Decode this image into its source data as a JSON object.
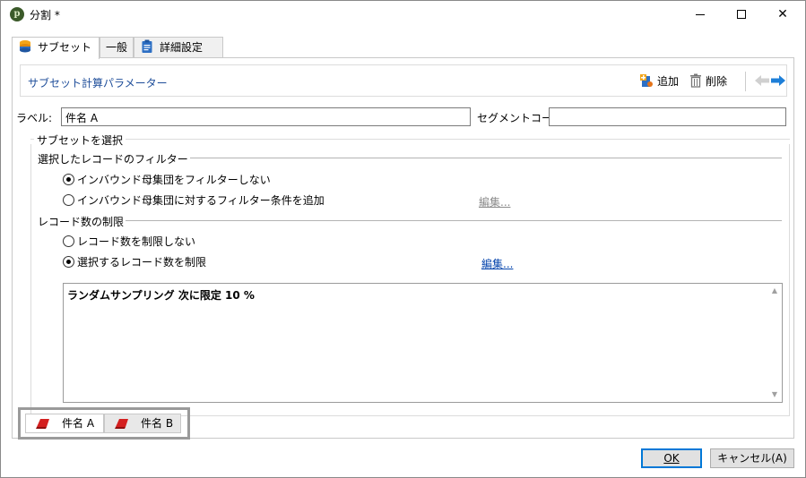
{
  "window": {
    "title": "分割 *"
  },
  "tabs": [
    {
      "label": "サブセット",
      "icon": "database-icon",
      "active": true
    },
    {
      "label": "一般",
      "active": false
    },
    {
      "label": "詳細設定",
      "icon": "clipboard-icon",
      "active": false
    }
  ],
  "section": {
    "title": "サブセット計算パラメーター",
    "add_label": "追加",
    "delete_label": "削除"
  },
  "form": {
    "label_caption": "ラベル:",
    "label_value": "件名 A",
    "segment_caption": "セグメントコード:",
    "segment_value": ""
  },
  "subset": {
    "legend": "サブセットを選択",
    "filter_heading": "選択したレコードのフィルター",
    "filter_options": [
      {
        "label": "インバウンド母集団をフィルターしない",
        "checked": true
      },
      {
        "label": "インバウンド母集団に対するフィルター条件を追加",
        "checked": false
      }
    ],
    "filter_edit": "編集...",
    "limit_heading": "レコード数の制限",
    "limit_options": [
      {
        "label": "レコード数を制限しない",
        "checked": false
      },
      {
        "label": "選択するレコード数を制限",
        "checked": true
      }
    ],
    "limit_edit": "編集...",
    "summary_text": "ランダムサンプリング 次に限定 10 %"
  },
  "bottom_tabs": [
    {
      "label": "件名 A",
      "icon": "subset-red-icon",
      "active": true
    },
    {
      "label": "件名 B",
      "icon": "subset-red-icon",
      "active": false
    }
  ],
  "buttons": {
    "ok_label": "OK",
    "cancel_label": "キャンセル(A)"
  },
  "colors": {
    "section_title": "#1f4e9a",
    "link": "#0645ad",
    "arrow_active": "#1e7fd8",
    "subset_icon": "#d42020"
  }
}
